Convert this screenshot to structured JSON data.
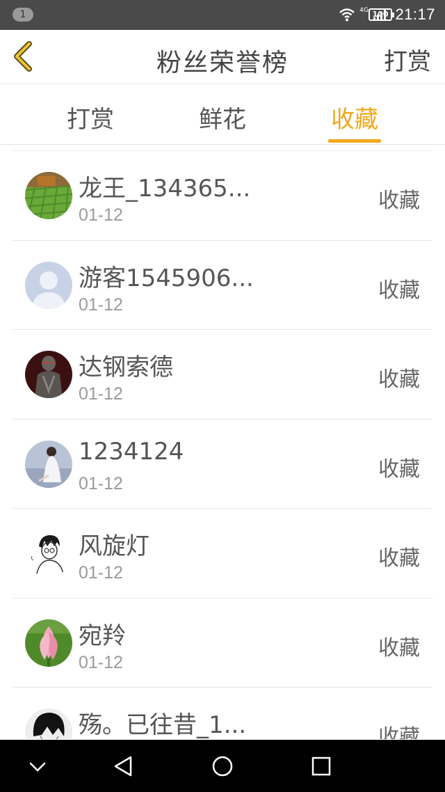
{
  "status_bar": {
    "notification_count": "1",
    "network_label": "4G",
    "battery": "100",
    "time": "21:17"
  },
  "header": {
    "title": "粉丝荣誉榜",
    "action": "打赏"
  },
  "tabs": [
    {
      "label": "打赏",
      "active": false
    },
    {
      "label": "鲜花",
      "active": false
    },
    {
      "label": "收藏",
      "active": true
    }
  ],
  "accent_color": "#f2a81d",
  "list": [
    {
      "name": "龙王_134365...",
      "date": "01-12",
      "type": "收藏",
      "avatar_icon": "farm-field-avatar"
    },
    {
      "name": "游客1545906...",
      "date": "01-12",
      "type": "收藏",
      "avatar_icon": "default-user-avatar"
    },
    {
      "name": "达钢索德",
      "date": "01-12",
      "type": "收藏",
      "avatar_icon": "armor-figure-avatar"
    },
    {
      "name": "1234124",
      "date": "01-12",
      "type": "收藏",
      "avatar_icon": "girl-photo-avatar"
    },
    {
      "name": "风旋灯",
      "date": "01-12",
      "type": "收藏",
      "avatar_icon": "sketch-boy-avatar"
    },
    {
      "name": "宛羚",
      "date": "01-12",
      "type": "收藏",
      "avatar_icon": "lotus-flower-avatar"
    },
    {
      "name": "殇。已往昔_1...",
      "date": "",
      "type": "收藏",
      "avatar_icon": "dark-hair-avatar"
    }
  ],
  "nav_bar": {
    "icons": [
      "chevron-down-icon",
      "back-triangle-icon",
      "home-circle-icon",
      "recents-square-icon"
    ]
  }
}
